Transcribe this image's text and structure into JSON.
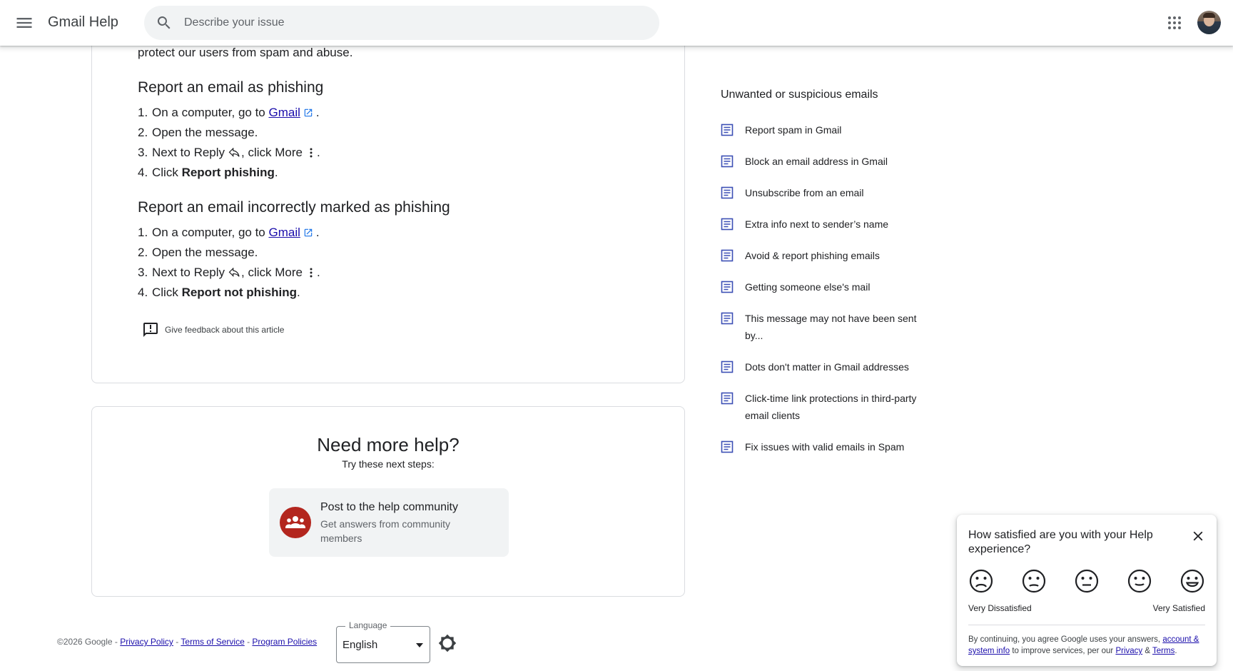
{
  "header": {
    "title": "Gmail Help",
    "search_placeholder": "Describe your issue"
  },
  "article": {
    "intro": "protect our users from spam and abuse.",
    "sections": [
      {
        "title": "Report an email as phishing",
        "steps": [
          {
            "num": "1.",
            "pre": "On a computer, go to ",
            "link": "Gmail",
            "post": "."
          },
          {
            "num": "2.",
            "text": "Open the message."
          },
          {
            "num": "3.",
            "pre": "Next to Reply",
            "mid": ", click More",
            "post": "."
          },
          {
            "num": "4.",
            "pre": "Click ",
            "bold": "Report phishing",
            "post": "."
          }
        ]
      },
      {
        "title": "Report an email incorrectly marked as phishing",
        "steps": [
          {
            "num": "1.",
            "pre": "On a computer, go to ",
            "link": "Gmail",
            "post": "."
          },
          {
            "num": "2.",
            "text": "Open the message."
          },
          {
            "num": "3.",
            "pre": "Next to Reply",
            "mid": ", click More",
            "post": "."
          },
          {
            "num": "4.",
            "pre": "Click ",
            "bold": "Report not phishing",
            "post": "."
          }
        ]
      }
    ],
    "feedback_label": "Give feedback about this article"
  },
  "sidebar": {
    "title": "Unwanted or suspicious emails",
    "items": [
      {
        "label": "Report spam in Gmail",
        "active": false
      },
      {
        "label": "Block an email address in Gmail",
        "active": false
      },
      {
        "label": "Unsubscribe from an email",
        "active": false
      },
      {
        "label": "Extra info next to sender’s name",
        "active": false
      },
      {
        "label": "Avoid & report phishing emails",
        "active": true
      },
      {
        "label": "Getting someone else's mail",
        "active": false
      },
      {
        "label": "This message may not have been sent by...",
        "active": false
      },
      {
        "label": "Dots don't matter in Gmail addresses",
        "active": false
      },
      {
        "label": "Click-time link protections in third-party email clients",
        "active": false
      },
      {
        "label": "Fix issues with valid emails in Spam",
        "active": false
      }
    ]
  },
  "help": {
    "title": "Need more help?",
    "subtitle": "Try these next steps:",
    "community_title": "Post to the help community",
    "community_desc": "Get answers from community members"
  },
  "footer": {
    "copyright": "©2026 Google",
    "sep": " - ",
    "privacy": "Privacy Policy",
    "terms": "Terms of Service",
    "program": "Program Policies",
    "language_label": "Language",
    "language_value": "English"
  },
  "survey": {
    "question": "How satisfied are you with your Help experience?",
    "low_label": "Very Dissatisfied",
    "high_label": "Very Satisfied",
    "legal_pre": "By continuing, you agree Google uses your answers, ",
    "legal_link1": "account & system info",
    "legal_mid": " to improve services, per our ",
    "legal_link2": "Privacy",
    "legal_amp": " & ",
    "legal_link3": "Terms",
    "legal_end": "."
  },
  "colors": {
    "link": "#1a0dab",
    "icon": "#5f6368",
    "doc_icon": "#3c4fb5",
    "community": "#b3261e"
  }
}
